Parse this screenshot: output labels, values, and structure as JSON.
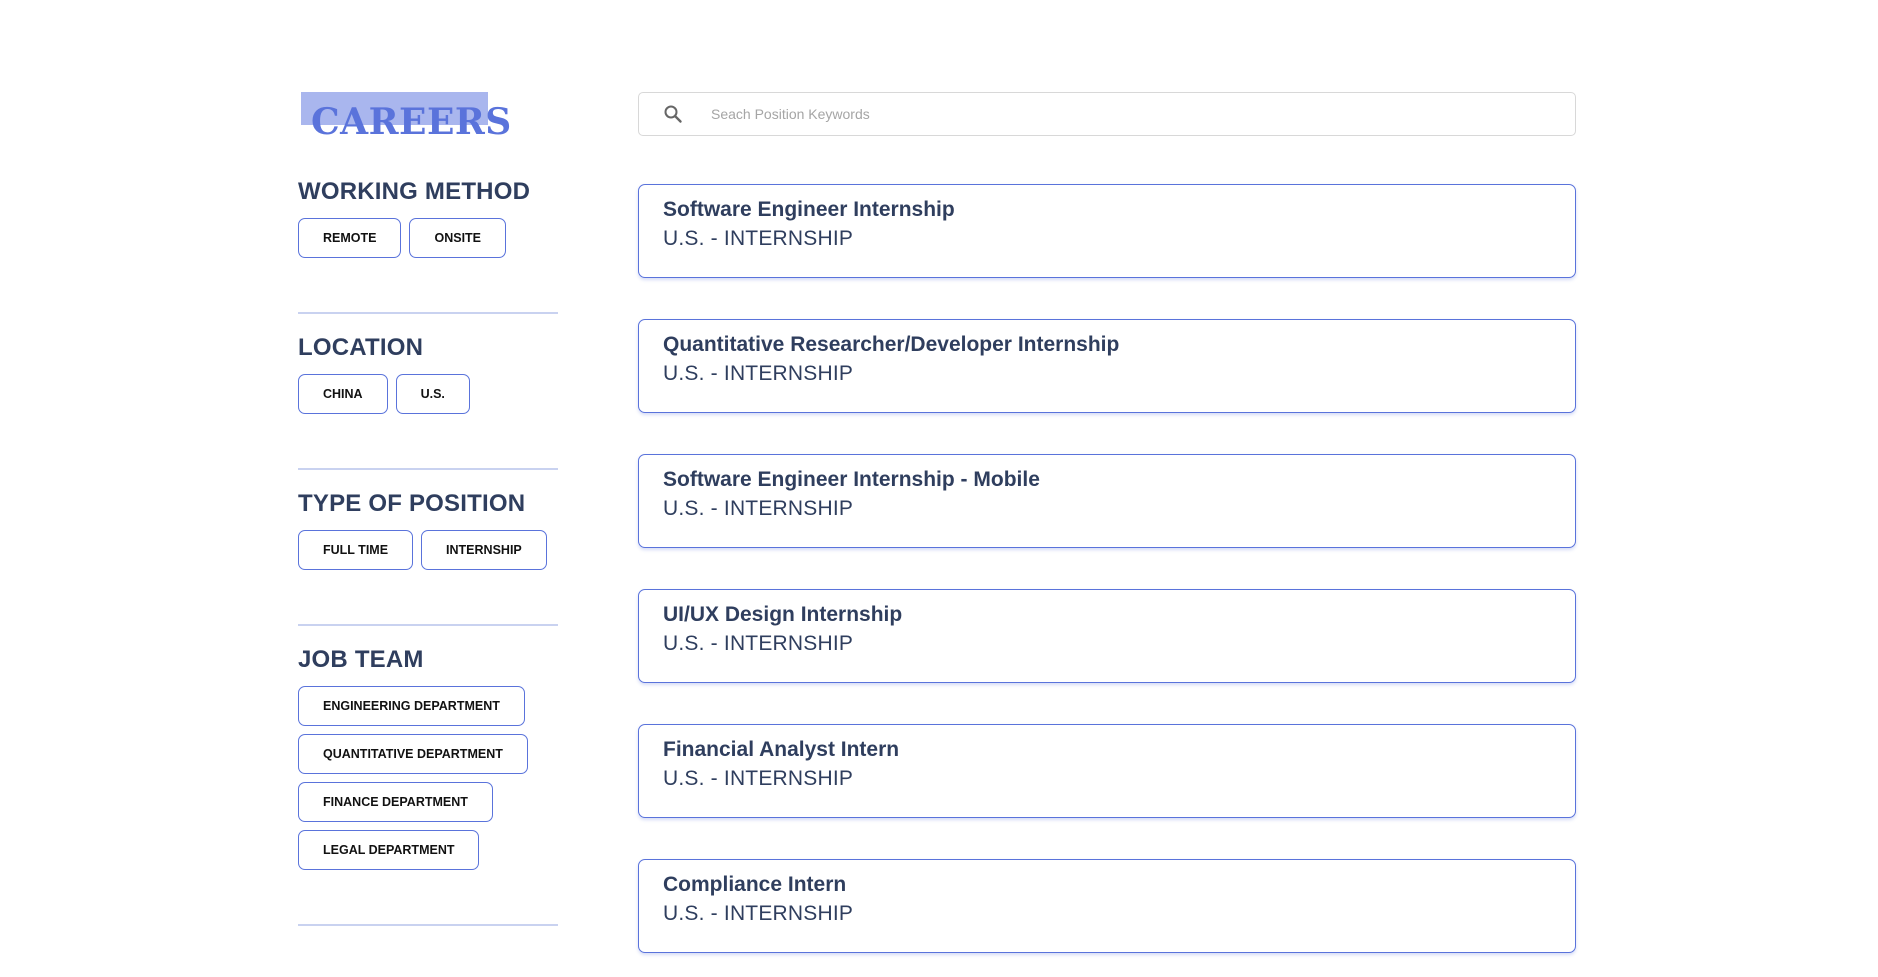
{
  "brand": {
    "title": "CAREERS"
  },
  "filters": {
    "working_method": {
      "title": "WORKING METHOD",
      "options": [
        "REMOTE",
        "ONSITE"
      ]
    },
    "location": {
      "title": "LOCATION",
      "options": [
        "CHINA",
        "U.S."
      ]
    },
    "type_of_position": {
      "title": "TYPE OF POSITION",
      "options": [
        "FULL TIME",
        "INTERNSHIP"
      ]
    },
    "job_team": {
      "title": "JOB TEAM",
      "options": [
        "ENGINEERING DEPARTMENT",
        "QUANTITATIVE DEPARTMENT",
        "FINANCE DEPARTMENT",
        "LEGAL DEPARTMENT"
      ]
    }
  },
  "search": {
    "placeholder": "Seach Position Keywords",
    "value": "",
    "icon": "search-icon"
  },
  "jobs": [
    {
      "title": "Software Engineer Internship",
      "meta": "U.S. - INTERNSHIP"
    },
    {
      "title": "Quantitative Researcher/Developer Internship",
      "meta": "U.S. - INTERNSHIP"
    },
    {
      "title": "Software Engineer Internship - Mobile",
      "meta": "U.S. - INTERNSHIP"
    },
    {
      "title": "UI/UX Design Internship",
      "meta": "U.S. - INTERNSHIP"
    },
    {
      "title": "Financial Analyst Intern",
      "meta": "U.S. - INTERNSHIP"
    },
    {
      "title": "Compliance Intern",
      "meta": "U.S. - INTERNSHIP"
    }
  ],
  "colors": {
    "accent": "#5a73db",
    "logo_highlight": "#a9b6ee",
    "text": "#2f3e5e",
    "divider": "#c9d2f0"
  }
}
